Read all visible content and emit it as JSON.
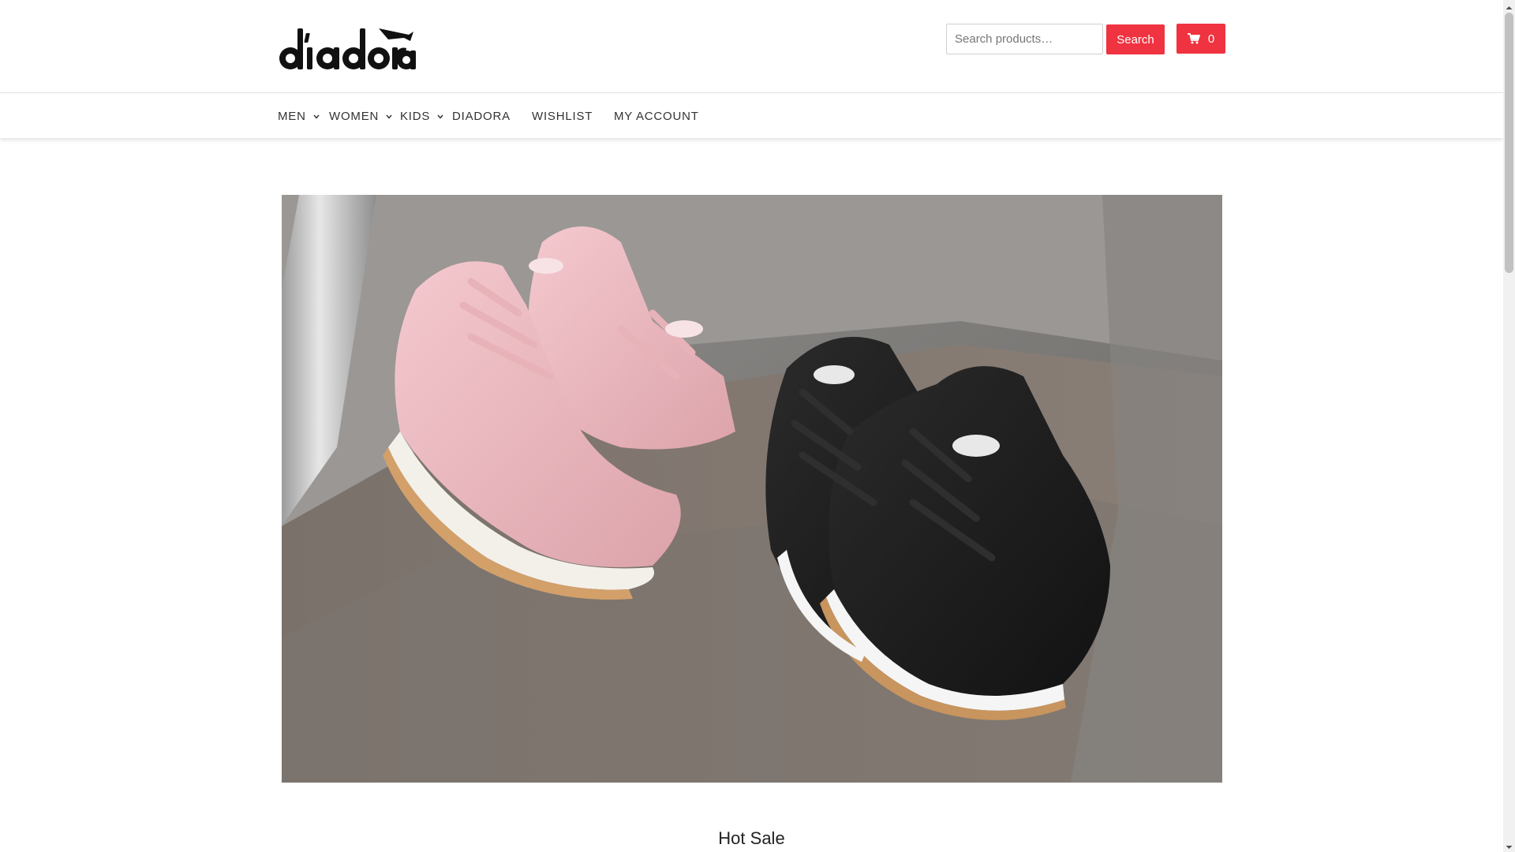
{
  "brand": {
    "logo_text": "diadora"
  },
  "header": {
    "search": {
      "placeholder": "Search products…",
      "value": ""
    },
    "search_button_label": "Search",
    "cart": {
      "count": "0",
      "icon": "cart-icon"
    }
  },
  "nav": {
    "items": [
      {
        "label": "MEN",
        "has_dropdown": true
      },
      {
        "label": "WOMEN",
        "has_dropdown": true
      },
      {
        "label": "KIDS",
        "has_dropdown": true
      },
      {
        "label": "DIADORA",
        "has_dropdown": false
      },
      {
        "label": "WISHLIST",
        "has_dropdown": false
      },
      {
        "label": "MY ACCOUNT",
        "has_dropdown": false
      }
    ]
  },
  "hero": {
    "subject": "pink and black diadora sneakers on stone steps"
  },
  "sections": {
    "hot_sale_title": "Hot Sale"
  },
  "colors": {
    "accent": "#ef3340",
    "text": "#333333",
    "border": "#e2e2e2"
  }
}
